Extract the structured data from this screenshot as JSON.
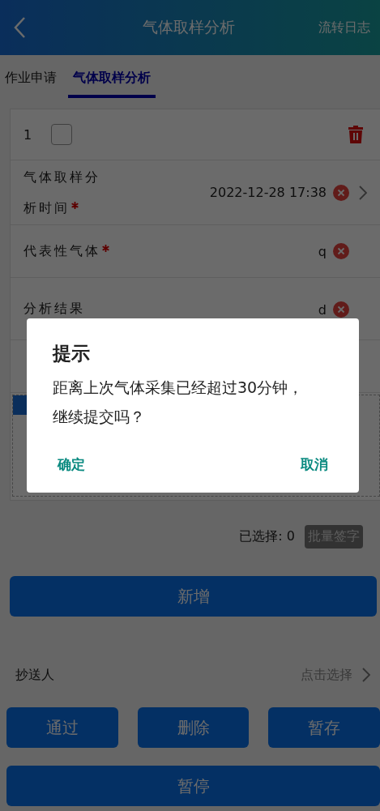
{
  "header": {
    "title": "气体取样分析",
    "action": "流转日志"
  },
  "tabs": [
    {
      "label": "作业申请",
      "selected": false
    },
    {
      "label": "气体取样分析",
      "selected": true
    }
  ],
  "record": {
    "index": "1",
    "checked": false,
    "fields": [
      {
        "label": "气体取样分析时间",
        "required": true,
        "value": "2022-12-28 17:38",
        "chevron": true
      },
      {
        "label": "代表性气体",
        "required": true,
        "value": "q",
        "chevron": false
      },
      {
        "label": "分析结果",
        "required": false,
        "value": "d",
        "chevron": false
      }
    ]
  },
  "selection": {
    "count_label": "已选择: 0",
    "batch_button": "批量签字"
  },
  "add_button": "新增",
  "cc": {
    "label": "抄送人",
    "placeholder": "点击选择"
  },
  "actions": [
    "通过",
    "删除",
    "暂存"
  ],
  "pause_button": "暂停",
  "dialog": {
    "title": "提示",
    "message": "距离上次气体采集已经超过30分钟，继续提交吗？",
    "confirm": "确定",
    "cancel": "取消"
  }
}
